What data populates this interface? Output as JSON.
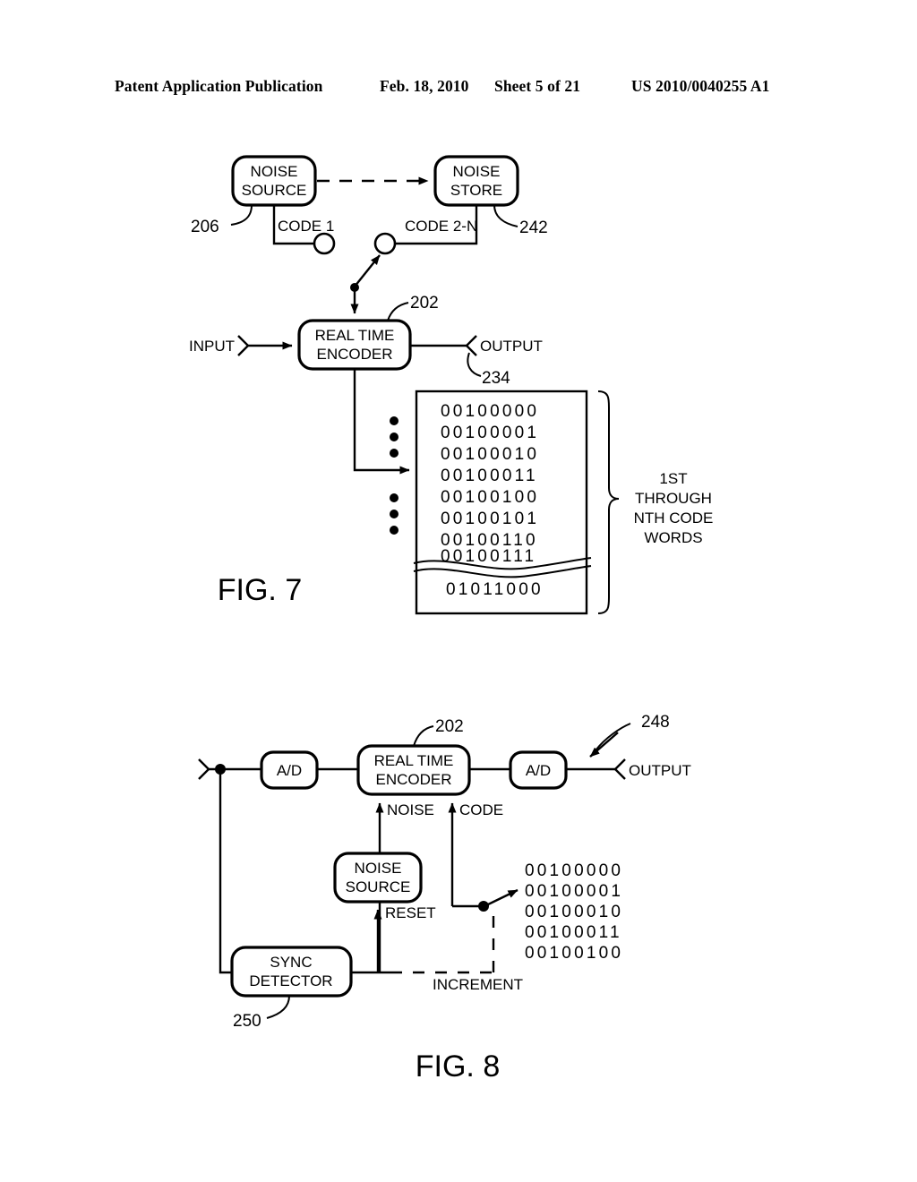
{
  "header": {
    "publication": "Patent Application Publication",
    "date": "Feb. 18, 2010",
    "sheet": "Sheet 5 of 21",
    "patent_number": "US 2010/0040255 A1"
  },
  "figures": [
    {
      "label": "FIG. 7",
      "blocks": {
        "noise_source": "NOISE\nSOURCE",
        "noise_source_line1": "NOISE",
        "noise_source_line2": "SOURCE",
        "noise_store_line1": "NOISE",
        "noise_store_line2": "STORE",
        "encoder_line1": "REAL TIME",
        "encoder_line2": "ENCODER"
      },
      "labels": {
        "code1": "CODE 1",
        "code2n": "CODE 2-N",
        "input": "INPUT",
        "output": "OUTPUT",
        "brace_line1": "1ST",
        "brace_line2": "THROUGH",
        "brace_line3": "NTH CODE",
        "brace_line4": "WORDS"
      },
      "refs": {
        "noise_source": "206",
        "noise_store": "242",
        "encoder": "202",
        "output": "234"
      },
      "code_words": [
        "00100000",
        "00100001",
        "00100010",
        "00100011",
        "00100100",
        "00100101",
        "00100110",
        "00100111"
      ],
      "code_words_after_break": [
        "01011000"
      ]
    },
    {
      "label": "FIG. 8",
      "blocks": {
        "ad_left": "A/D",
        "ad_right": "A/D",
        "encoder_line1": "REAL TIME",
        "encoder_line2": "ENCODER",
        "noise_source_line1": "NOISE",
        "noise_source_line2": "SOURCE",
        "sync_detector_line1": "SYNC",
        "sync_detector_line2": "DETECTOR"
      },
      "labels": {
        "output": "OUTPUT",
        "noise": "NOISE",
        "code": "CODE",
        "reset": "RESET",
        "increment": "INCREMENT"
      },
      "refs": {
        "encoder": "202",
        "system": "248",
        "sync_detector": "250"
      },
      "code_words": [
        "00100000",
        "00100001",
        "00100010",
        "00100011",
        "00100100"
      ]
    }
  ]
}
